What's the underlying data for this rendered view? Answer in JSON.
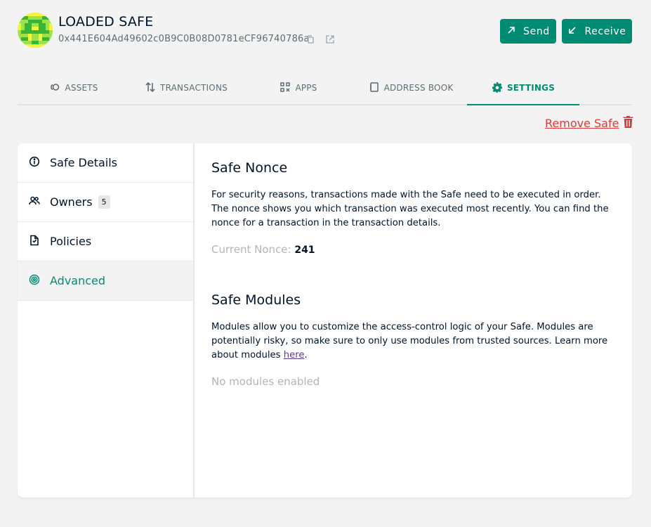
{
  "header": {
    "safe_name": "LOADED SAFE",
    "safe_address": "0x441E604Ad49602c0B9C0B08D0781eCF96740786a",
    "send_label": "Send",
    "receive_label": "Receive",
    "icons": {
      "copy": "copy-icon",
      "external": "external-link-icon",
      "send": "arrow-up-right-icon",
      "receive": "arrow-down-left-icon"
    }
  },
  "tabs": [
    {
      "label": "ASSETS",
      "icon": "assets-icon",
      "active": false
    },
    {
      "label": "TRANSACTIONS",
      "icon": "transactions-icon",
      "active": false
    },
    {
      "label": "APPS",
      "icon": "apps-icon",
      "active": false
    },
    {
      "label": "ADDRESS BOOK",
      "icon": "address-book-icon",
      "active": false
    },
    {
      "label": "SETTINGS",
      "icon": "gear-icon",
      "active": true
    }
  ],
  "remove_safe_label": "Remove Safe",
  "sidebar": {
    "items": [
      {
        "label": "Safe Details",
        "icon": "info-icon",
        "active": false
      },
      {
        "label": "Owners",
        "icon": "owners-icon",
        "badge": "5",
        "active": false
      },
      {
        "label": "Policies",
        "icon": "policies-icon",
        "active": false
      },
      {
        "label": "Advanced",
        "icon": "advanced-icon",
        "active": true
      }
    ]
  },
  "nonce": {
    "title": "Safe Nonce",
    "description": "For security reasons, transactions made with the Safe need to be executed in order. The nonce shows you which transaction was executed most recently. You can find the nonce for a transaction in the transaction details.",
    "current_label": "Current Nonce:",
    "current_value": "241"
  },
  "modules": {
    "title": "Safe Modules",
    "description_prefix": "Modules allow you to customize the access-control logic of your Safe. Modules are potentially risky, so make sure to only use modules from trusted sources. Learn more about modules",
    "link_text": "here",
    "description_suffix": ".",
    "empty_text": "No modules enabled"
  },
  "colors": {
    "accent": "#008c73",
    "danger": "#db3a3d",
    "text": "#001428",
    "muted": "#b2b5b2",
    "link": "#5b3c89",
    "background": "#f4f3f3"
  }
}
